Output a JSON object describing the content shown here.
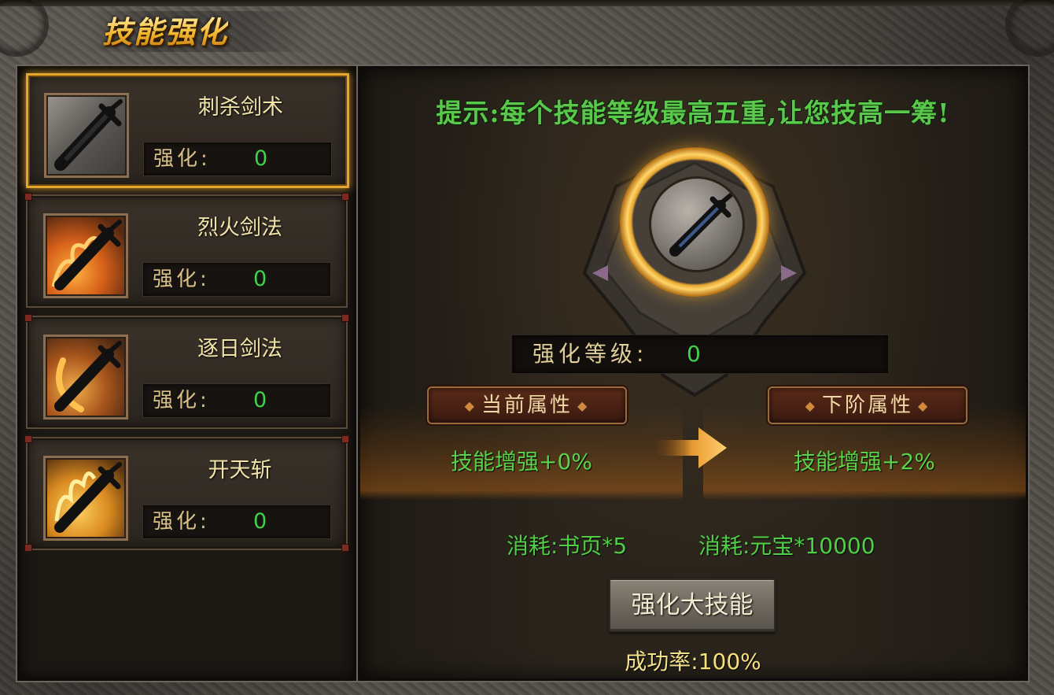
{
  "window": {
    "title": "技能强化"
  },
  "skills": [
    {
      "name": "刺杀剑术",
      "enh_label": "强化:",
      "enh_value": "0",
      "icon": "sword-icon",
      "selected": true
    },
    {
      "name": "烈火剑法",
      "enh_label": "强化:",
      "enh_value": "0",
      "icon": "fire-sword-icon",
      "selected": false
    },
    {
      "name": "逐日剑法",
      "enh_label": "强化:",
      "enh_value": "0",
      "icon": "crescent-sword-icon",
      "selected": false
    },
    {
      "name": "开天斩",
      "enh_label": "强化:",
      "enh_value": "0",
      "icon": "flame-sword-icon",
      "selected": false
    }
  ],
  "detail": {
    "hint": "提示:每个技能等级最高五重,让您技高一筹!",
    "level_label": "强化等级:",
    "level_value": "0",
    "current_header": "当前属性",
    "current_value": "技能增强+0%",
    "next_header": "下阶属性",
    "next_value": "技能增强+2%",
    "cost1": "消耗:书页*5",
    "cost2": "消耗:元宝*10000",
    "button_label": "强化大技能",
    "rate_label": "成功率:",
    "rate_value": "100%"
  },
  "colors": {
    "accent_gold": "#e3a52c",
    "value_green": "#3fd24a",
    "hint_green": "#5ac84a"
  }
}
